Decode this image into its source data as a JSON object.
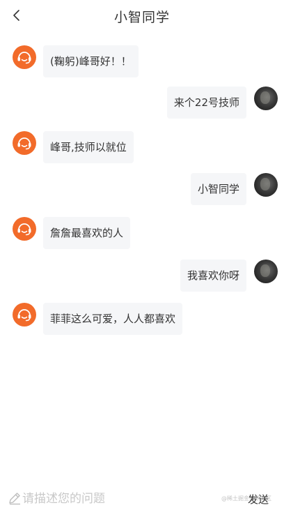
{
  "header": {
    "title": "小智同学",
    "back_icon": "chevron-left-icon"
  },
  "colors": {
    "bot_avatar": "#f26b2a",
    "bubble_bg": "#f5f6f8",
    "text": "#333333",
    "placeholder": "#c8c8c8"
  },
  "messages": [
    {
      "from": "bot",
      "text": "(鞠躬)峰哥好！！"
    },
    {
      "from": "user",
      "text": "来个22号技师"
    },
    {
      "from": "bot",
      "text": "峰哥,技师以就位"
    },
    {
      "from": "user",
      "text": "小智同学"
    },
    {
      "from": "bot",
      "text": "詹詹最喜欢的人"
    },
    {
      "from": "user",
      "text": "我喜欢你呀"
    },
    {
      "from": "bot",
      "text": "菲菲这么可爱，人人都喜欢"
    }
  ],
  "composer": {
    "placeholder": "请描述您的问题",
    "send_label": "发送",
    "icon": "pencil-icon"
  },
  "watermark": "@稀土掘金技术社区"
}
